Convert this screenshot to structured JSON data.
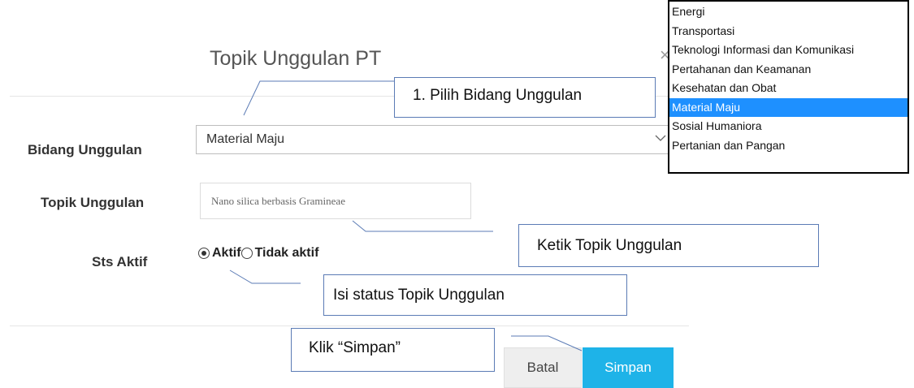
{
  "modal": {
    "title": "Topik Unggulan PT",
    "close_symbol": "×"
  },
  "form": {
    "bidang_label": "Bidang Unggulan",
    "bidang_value": "Material Maju",
    "topik_label": "Topik Unggulan",
    "topik_value": "Nano silica berbasis Gramineae",
    "sts_label": "Sts Aktif",
    "radio_aktif": "Aktif",
    "radio_tidak_aktif": "Tidak aktif",
    "radio_selected": "Aktif"
  },
  "dropdown": {
    "options": [
      "Energi",
      "Transportasi",
      "Teknologi Informasi dan Komunikasi",
      "Pertahanan dan Keamanan",
      "Kesehatan dan Obat",
      "Material Maju",
      "Sosial Humaniora",
      "Pertanian dan Pangan"
    ],
    "selected": "Material Maju",
    "selected_color": "#1e90ff"
  },
  "buttons": {
    "batal_label": "Batal",
    "simpan_label": "Simpan",
    "simpan_color": "#1eb3e8"
  },
  "callouts": {
    "step1": "1.  Pilih Bidang Unggulan",
    "step2": "Ketik Topik Unggulan",
    "step3": "Isi status Topik Unggulan",
    "step4": "Klik “Simpan”"
  },
  "icons": {
    "close": "close-icon",
    "select_arrow": "chevron-down-icon",
    "radio": "radio-icon"
  }
}
